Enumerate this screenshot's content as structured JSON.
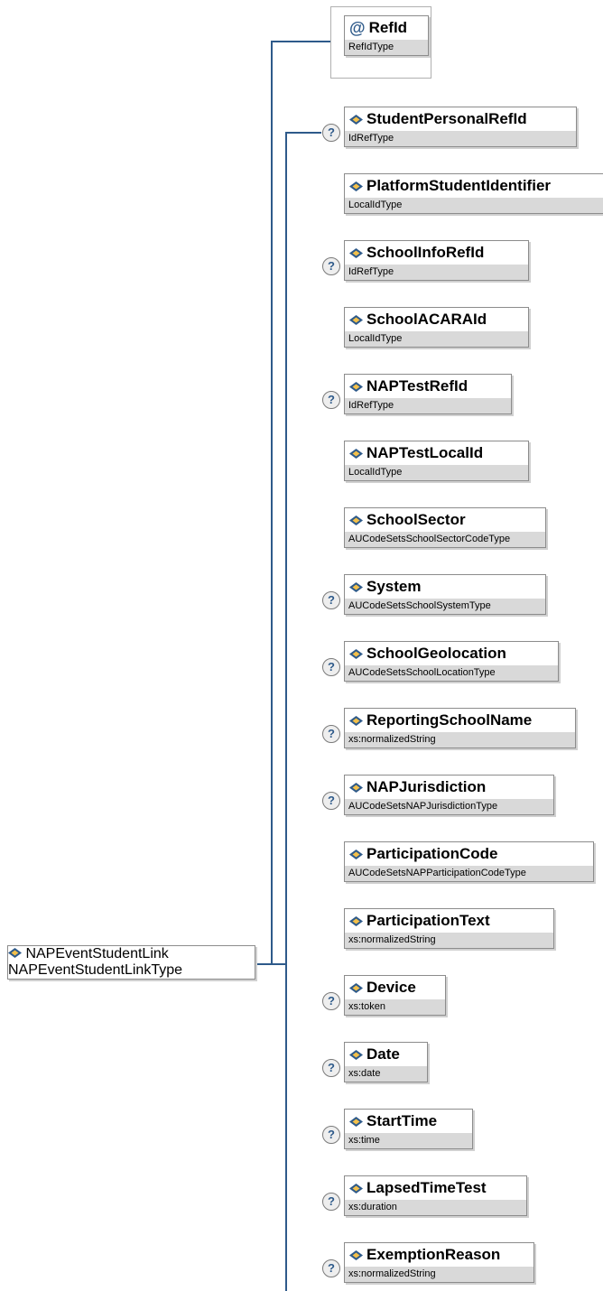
{
  "root": {
    "name": "NAPEventStudentLink",
    "type": "NAPEventStudentLinkType"
  },
  "attribute": {
    "name": "RefId",
    "type": "RefIdType"
  },
  "elements": [
    {
      "name": "StudentPersonalRefId",
      "type": "IdRefType",
      "optional": true
    },
    {
      "name": "PlatformStudentIdentifier",
      "type": "LocalIdType",
      "optional": false
    },
    {
      "name": "SchoolInfoRefId",
      "type": "IdRefType",
      "optional": true
    },
    {
      "name": "SchoolACARAId",
      "type": "LocalIdType",
      "optional": false
    },
    {
      "name": "NAPTestRefId",
      "type": "IdRefType",
      "optional": true
    },
    {
      "name": "NAPTestLocalId",
      "type": "LocalIdType",
      "optional": false
    },
    {
      "name": "SchoolSector",
      "type": "AUCodeSetsSchoolSectorCodeType",
      "optional": false
    },
    {
      "name": "System",
      "type": "AUCodeSetsSchoolSystemType",
      "optional": true
    },
    {
      "name": "SchoolGeolocation",
      "type": "AUCodeSetsSchoolLocationType",
      "optional": true
    },
    {
      "name": "ReportingSchoolName",
      "type": "xs:normalizedString",
      "optional": true
    },
    {
      "name": "NAPJurisdiction",
      "type": "AUCodeSetsNAPJurisdictionType",
      "optional": true
    },
    {
      "name": "ParticipationCode",
      "type": "AUCodeSetsNAPParticipationCodeType",
      "optional": false
    },
    {
      "name": "ParticipationText",
      "type": "xs:normalizedString",
      "optional": false
    },
    {
      "name": "Device",
      "type": "xs:token",
      "optional": true
    },
    {
      "name": "Date",
      "type": "xs:date",
      "optional": true
    },
    {
      "name": "StartTime",
      "type": "xs:time",
      "optional": true
    },
    {
      "name": "LapsedTimeTest",
      "type": "xs:duration",
      "optional": true
    },
    {
      "name": "ExemptionReason",
      "type": "xs:normalizedString",
      "optional": true
    }
  ],
  "icons": {
    "element": "element-icon",
    "attribute": "attribute-at-icon",
    "optional": "optional-question-icon"
  },
  "optional_glyph": "?",
  "attribute_glyph": "@",
  "colors": {
    "connector": "#2e5a8a",
    "type_bar": "#d9d9d9",
    "border": "#8c8c8c"
  }
}
